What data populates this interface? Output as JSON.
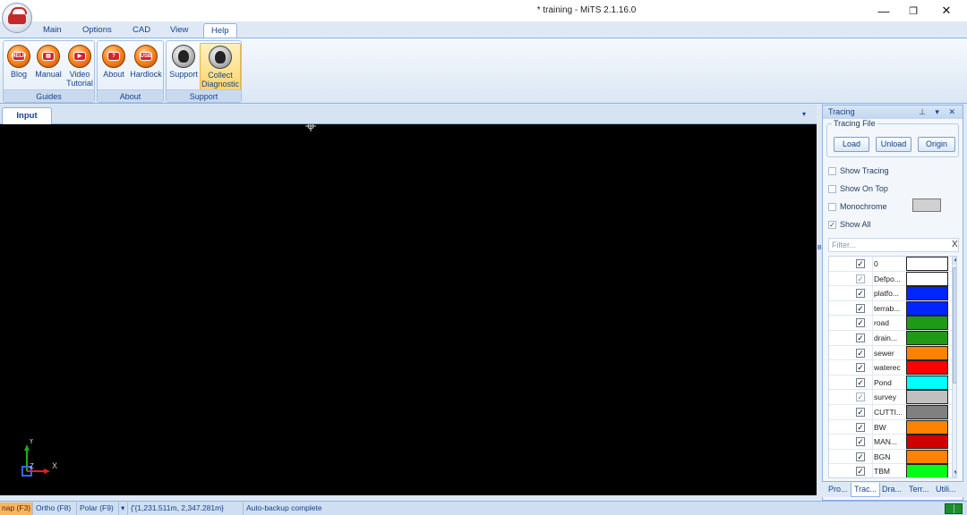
{
  "window": {
    "title": "* training - MiTS 2.1.16.0"
  },
  "ribbon": {
    "tabs": [
      "Main",
      "Options",
      "CAD",
      "View",
      "Help"
    ],
    "active_tab": "Help",
    "groups": [
      {
        "label": "Guides",
        "buttons": [
          {
            "line1": "Blog",
            "line2": "",
            "icon": "blog-icon"
          },
          {
            "line1": "Manual",
            "line2": "",
            "icon": "manual-icon"
          },
          {
            "line1": "Video",
            "line2": "Tutorial",
            "icon": "video-tutorial-icon"
          }
        ]
      },
      {
        "label": "About",
        "buttons": [
          {
            "line1": "About",
            "line2": "",
            "icon": "about-icon"
          },
          {
            "line1": "Hardlock",
            "line2": "",
            "icon": "hardlock-icon"
          }
        ]
      },
      {
        "label": "Support",
        "buttons": [
          {
            "line1": "Support",
            "line2": "",
            "icon": "support-icon"
          },
          {
            "line1": "Collect",
            "line2": "Diagnostic",
            "icon": "collect-diagnostic-icon"
          }
        ]
      }
    ]
  },
  "document": {
    "tab_label": "Input",
    "menu_glyph": "▾"
  },
  "canvas": {
    "axis_x": "X",
    "axis_y": "Y",
    "axis_z": "Z"
  },
  "side_marker": "B",
  "tracing": {
    "title": "Tracing",
    "head_icons": "⊥ ▾ ✕",
    "tracing_file_label": "Tracing File",
    "buttons": [
      "Load",
      "Unload",
      "Origin"
    ],
    "options": [
      {
        "label": "Show Tracing",
        "checked": false
      },
      {
        "label": "Show On Top",
        "checked": false
      },
      {
        "label": "Monochrome",
        "checked": false
      },
      {
        "label": "Show All",
        "checked": true
      }
    ],
    "monochrome_color": "#d0d0d0",
    "filter_placeholder": "Filter...",
    "filter_clear": "X",
    "layers": [
      {
        "name": "0",
        "color": "#ffffff",
        "checked": true,
        "dim": false
      },
      {
        "name": "Defpo...",
        "color": "#ffffff",
        "checked": true,
        "dim": true
      },
      {
        "name": "platfo...",
        "color": "#0026ff",
        "checked": true,
        "dim": false
      },
      {
        "name": "terrab...",
        "color": "#0026ff",
        "checked": true,
        "dim": false
      },
      {
        "name": "road",
        "color": "#1f9a16",
        "checked": true,
        "dim": false
      },
      {
        "name": "drain...",
        "color": "#1f9a16",
        "checked": true,
        "dim": false
      },
      {
        "name": "sewer",
        "color": "#ff8200",
        "checked": true,
        "dim": false
      },
      {
        "name": "waterec",
        "color": "#ff0000",
        "checked": true,
        "dim": false
      },
      {
        "name": "Pond",
        "color": "#00ffff",
        "checked": true,
        "dim": false
      },
      {
        "name": "survey",
        "color": "#c0c0c0",
        "checked": true,
        "dim": true
      },
      {
        "name": "CUTTI...",
        "color": "#808080",
        "checked": true,
        "dim": false
      },
      {
        "name": "BW",
        "color": "#ff8200",
        "checked": true,
        "dim": false
      },
      {
        "name": "MAN...",
        "color": "#d00000",
        "checked": true,
        "dim": false
      },
      {
        "name": "BGN",
        "color": "#ff8200",
        "checked": true,
        "dim": false
      },
      {
        "name": "TBM",
        "color": "#00ff14",
        "checked": true,
        "dim": false
      }
    ],
    "bottom_tabs": [
      "Pro...",
      "Trac...",
      "Dra...",
      "Terr...",
      "Utili..."
    ],
    "active_bottom_tab": "Trac..."
  },
  "status": {
    "snap": "nap (F3)",
    "ortho": "Ortho (F8)",
    "polar": "Polar (F9)",
    "polar_arrow": "▾",
    "coords": "{'{1,231.511m, 2,347.281m}",
    "message": "Auto-backup complete"
  },
  "colors": {
    "accent": "#15428b",
    "canvas_bg": "#000000",
    "snap_highlight": "#f9b560"
  }
}
